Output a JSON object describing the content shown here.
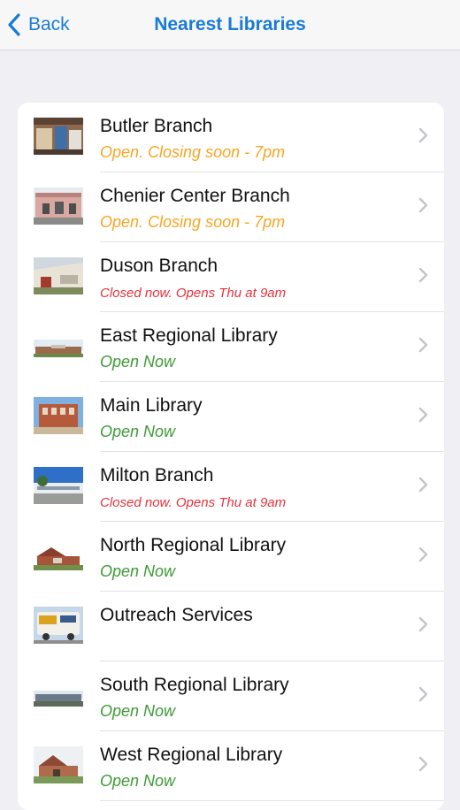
{
  "nav": {
    "back_label": "Back",
    "title": "Nearest Libraries"
  },
  "colors": {
    "accent": "#1a7bd6",
    "closing_soon": "#f5a623",
    "closed": "#e8323c",
    "open": "#3e9a36"
  },
  "libraries": [
    {
      "name": "Butler Branch",
      "status": "Open. Closing soon - 7pm",
      "status_type": "closing"
    },
    {
      "name": "Chenier Center Branch",
      "status": "Open. Closing soon - 7pm",
      "status_type": "closing"
    },
    {
      "name": "Duson Branch",
      "status": "Closed now. Opens Thu at 9am",
      "status_type": "closed"
    },
    {
      "name": "East Regional Library",
      "status": "Open Now",
      "status_type": "open"
    },
    {
      "name": "Main Library",
      "status": "Open Now",
      "status_type": "open"
    },
    {
      "name": "Milton Branch",
      "status": "Closed now. Opens Thu at 9am",
      "status_type": "closed"
    },
    {
      "name": "North Regional Library",
      "status": "Open Now",
      "status_type": "open"
    },
    {
      "name": "Outreach Services",
      "status": "",
      "status_type": "none"
    },
    {
      "name": "South Regional Library",
      "status": "Open Now",
      "status_type": "open"
    },
    {
      "name": "West Regional Library",
      "status": "Open Now",
      "status_type": "open"
    }
  ]
}
